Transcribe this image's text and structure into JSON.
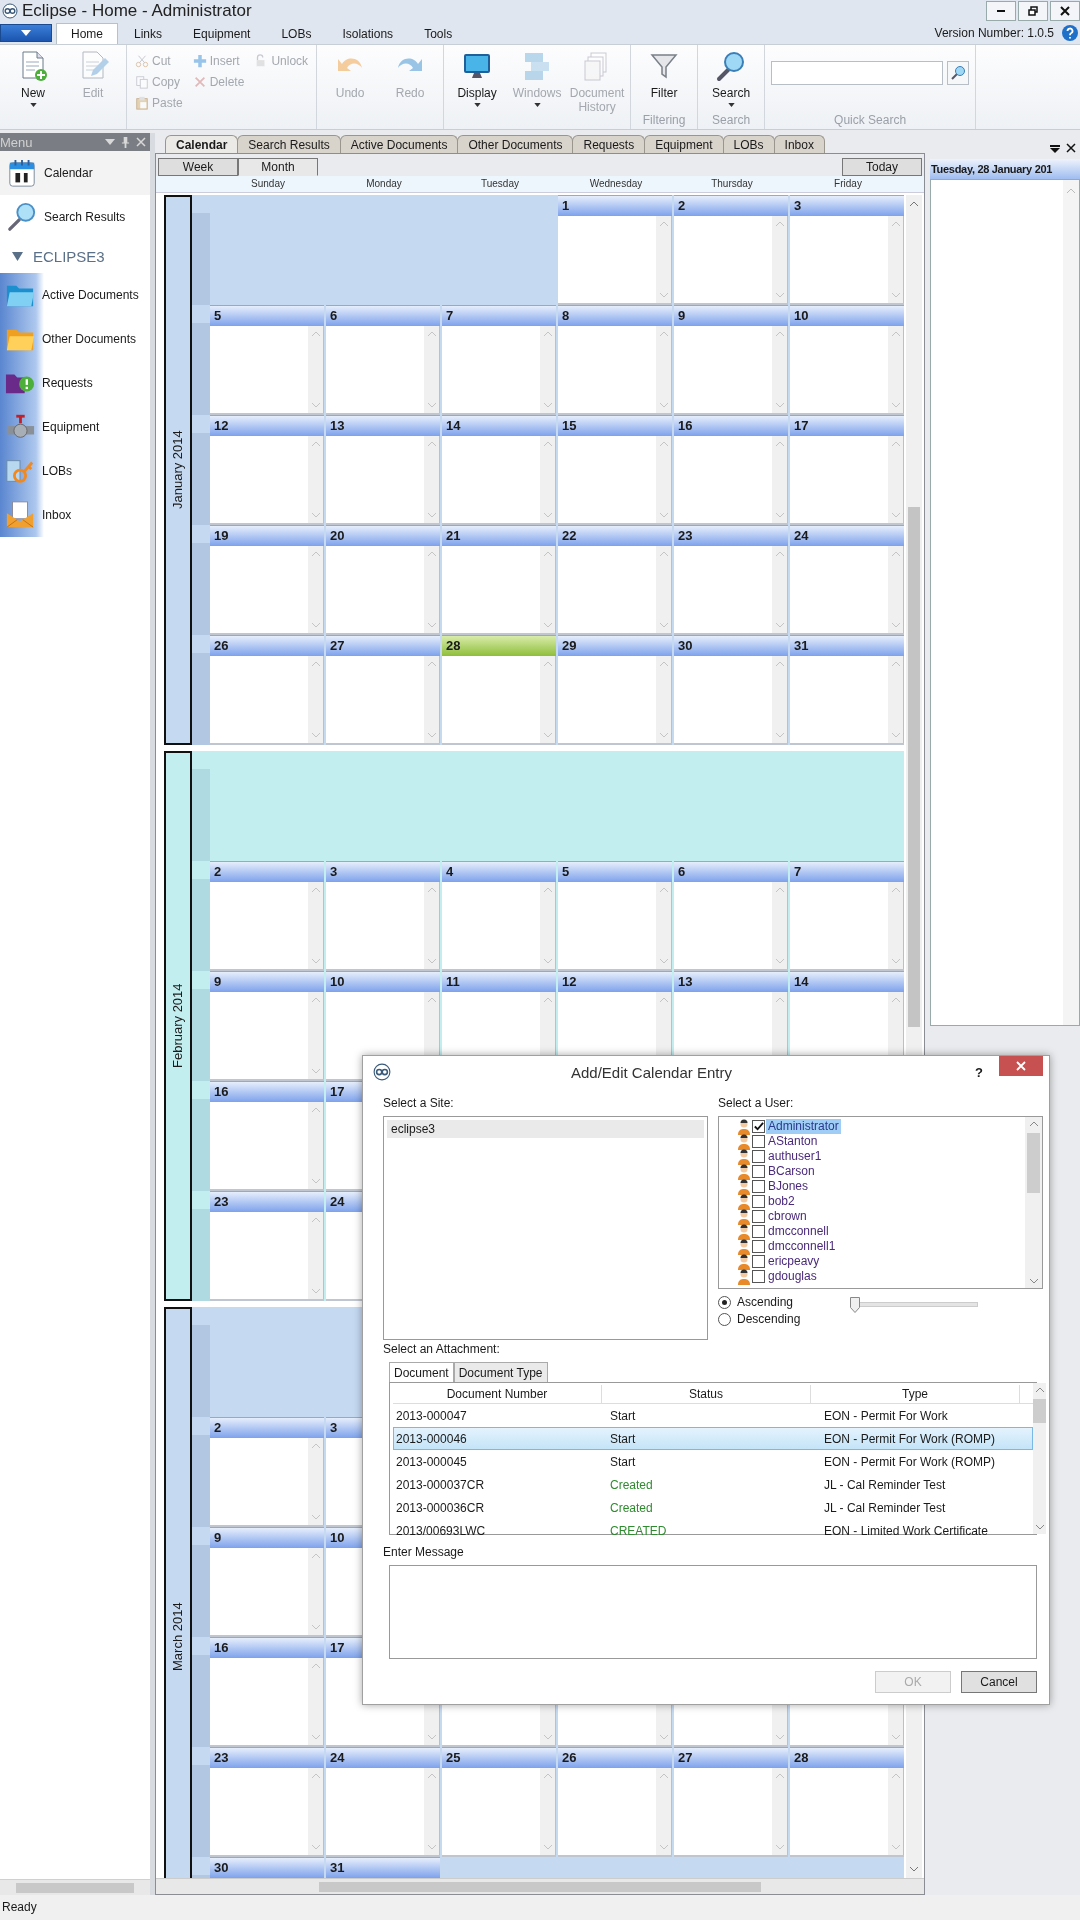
{
  "window": {
    "title": "Eclipse - Home - Administrator"
  },
  "ribbon": {
    "tabs": [
      {
        "label": "Home",
        "selected": true
      },
      {
        "label": "Links",
        "selected": false
      },
      {
        "label": "Equipment",
        "selected": false
      },
      {
        "label": "LOBs",
        "selected": false
      },
      {
        "label": "Isolations",
        "selected": false
      },
      {
        "label": "Tools",
        "selected": false
      }
    ],
    "version": "Version Number: 1.0.5",
    "groups": [
      {
        "kind": "large",
        "buttons": [
          {
            "label": "New",
            "disabled": false,
            "caret": true
          },
          {
            "label": "Edit",
            "disabled": true,
            "caret": false
          }
        ]
      },
      {
        "kind": "small",
        "columns": [
          [
            {
              "label": "Cut",
              "disabled": true
            },
            {
              "label": "Copy",
              "disabled": true
            },
            {
              "label": "Paste",
              "disabled": true
            }
          ],
          [
            {
              "label": "Insert",
              "disabled": true
            },
            {
              "label": "Delete",
              "disabled": true
            }
          ],
          [
            {
              "label": "Unlock",
              "disabled": true
            }
          ]
        ]
      },
      {
        "kind": "large",
        "buttons": [
          {
            "label": "Undo",
            "disabled": true,
            "caret": false
          },
          {
            "label": "Redo",
            "disabled": true,
            "caret": false
          }
        ]
      },
      {
        "kind": "large",
        "buttons": [
          {
            "label": "Display",
            "disabled": false,
            "caret": true
          },
          {
            "label": "Windows",
            "disabled": true,
            "caret": true
          },
          {
            "label": "Document History",
            "disabled": true,
            "caret": false
          }
        ]
      },
      {
        "kind": "large",
        "label": "Filtering",
        "buttons": [
          {
            "label": "Filter",
            "disabled": false,
            "caret": false
          }
        ]
      },
      {
        "kind": "large",
        "label": "Search",
        "buttons": [
          {
            "label": "Search",
            "disabled": false,
            "caret": true
          }
        ]
      },
      {
        "kind": "search",
        "label": "Quick Search"
      }
    ]
  },
  "menu": {
    "title": "Menu",
    "items": [
      {
        "label": "Calendar",
        "selected": true
      },
      {
        "label": "Search Results",
        "selected": false
      }
    ],
    "section": {
      "label": "ECLIPSE3",
      "expanded": true,
      "children": [
        {
          "label": "Active Documents",
          "selected": false
        },
        {
          "label": "Other Documents",
          "selected": false
        },
        {
          "label": "Requests",
          "selected": false
        },
        {
          "label": "Equipment",
          "selected": false
        },
        {
          "label": "LOBs",
          "selected": false
        },
        {
          "label": "Inbox",
          "selected": false
        }
      ]
    }
  },
  "document_tabs": [
    {
      "label": "Calendar",
      "selected": true
    },
    {
      "label": "Search Results",
      "selected": false
    },
    {
      "label": "Active Documents",
      "selected": false
    },
    {
      "label": "Other Documents",
      "selected": false
    },
    {
      "label": "Requests",
      "selected": false
    },
    {
      "label": "Equipment",
      "selected": false
    },
    {
      "label": "LOBs",
      "selected": false
    },
    {
      "label": "Inbox",
      "selected": false
    }
  ],
  "calendar": {
    "views": [
      {
        "label": "Week",
        "selected": false
      },
      {
        "label": "Month",
        "selected": true
      }
    ],
    "today_button": "Today",
    "weekdays": [
      "Sunday",
      "Monday",
      "Tuesday",
      "Wednesday",
      "Thursday",
      "Friday"
    ],
    "months": [
      {
        "label": "January 2014",
        "color": "#c5d9f1",
        "weeks": [
          [
            {
              "kind": "blank"
            },
            {
              "kind": "blank"
            },
            {
              "kind": "blank"
            },
            {
              "kind": "day",
              "day": "1",
              "today": false
            },
            {
              "kind": "day",
              "day": "2",
              "today": false
            },
            {
              "kind": "day",
              "day": "3",
              "today": false
            }
          ],
          [
            {
              "kind": "day",
              "day": "5",
              "today": false
            },
            {
              "kind": "day",
              "day": "6",
              "today": false
            },
            {
              "kind": "day",
              "day": "7",
              "today": false
            },
            {
              "kind": "day",
              "day": "8",
              "today": false
            },
            {
              "kind": "day",
              "day": "9",
              "today": false
            },
            {
              "kind": "day",
              "day": "10",
              "today": false
            }
          ],
          [
            {
              "kind": "day",
              "day": "12",
              "today": false
            },
            {
              "kind": "day",
              "day": "13",
              "today": false
            },
            {
              "kind": "day",
              "day": "14",
              "today": false
            },
            {
              "kind": "day",
              "day": "15",
              "today": false
            },
            {
              "kind": "day",
              "day": "16",
              "today": false
            },
            {
              "kind": "day",
              "day": "17",
              "today": false
            }
          ],
          [
            {
              "kind": "day",
              "day": "19",
              "today": false
            },
            {
              "kind": "day",
              "day": "20",
              "today": false
            },
            {
              "kind": "day",
              "day": "21",
              "today": false
            },
            {
              "kind": "day",
              "day": "22",
              "today": false
            },
            {
              "kind": "day",
              "day": "23",
              "today": false
            },
            {
              "kind": "day",
              "day": "24",
              "today": false
            }
          ],
          [
            {
              "kind": "day",
              "day": "26",
              "today": false
            },
            {
              "kind": "day",
              "day": "27",
              "today": false
            },
            {
              "kind": "day",
              "day": "28",
              "today": true
            },
            {
              "kind": "day",
              "day": "29",
              "today": false
            },
            {
              "kind": "day",
              "day": "30",
              "today": false
            },
            {
              "kind": "day",
              "day": "31",
              "today": false
            }
          ]
        ]
      },
      {
        "label": "February 2014",
        "color": "#c3eef0",
        "weeks": [
          [
            {
              "kind": "blank"
            },
            {
              "kind": "blank"
            },
            {
              "kind": "blank"
            },
            {
              "kind": "blank"
            },
            {
              "kind": "blank"
            },
            {
              "kind": "blank"
            }
          ],
          [
            {
              "kind": "day",
              "day": "2",
              "today": false
            },
            {
              "kind": "day",
              "day": "3",
              "today": false
            },
            {
              "kind": "day",
              "day": "4",
              "today": false
            },
            {
              "kind": "day",
              "day": "5",
              "today": false
            },
            {
              "kind": "day",
              "day": "6",
              "today": false
            },
            {
              "kind": "day",
              "day": "7",
              "today": false
            }
          ],
          [
            {
              "kind": "day",
              "day": "9",
              "today": false
            },
            {
              "kind": "day",
              "day": "10",
              "today": false
            },
            {
              "kind": "day",
              "day": "11",
              "today": false
            },
            {
              "kind": "day",
              "day": "12",
              "today": false
            },
            {
              "kind": "day",
              "day": "13",
              "today": false
            },
            {
              "kind": "day",
              "day": "14",
              "today": false
            }
          ],
          [
            {
              "kind": "day",
              "day": "16",
              "today": false
            },
            {
              "kind": "day",
              "day": "17",
              "today": false
            },
            {
              "kind": "covered"
            },
            {
              "kind": "covered"
            },
            {
              "kind": "covered"
            },
            {
              "kind": "covered"
            }
          ],
          [
            {
              "kind": "day",
              "day": "23",
              "today": false
            },
            {
              "kind": "day",
              "day": "24",
              "today": false
            },
            {
              "kind": "covered"
            },
            {
              "kind": "covered"
            },
            {
              "kind": "covered"
            },
            {
              "kind": "covered"
            }
          ]
        ]
      },
      {
        "label": "March 2014",
        "color": "#c5d9f1",
        "weeks": [
          [
            {
              "kind": "blank"
            },
            {
              "kind": "blank"
            },
            {
              "kind": "blank"
            },
            {
              "kind": "blank"
            },
            {
              "kind": "blank"
            },
            {
              "kind": "blank"
            }
          ],
          [
            {
              "kind": "day",
              "day": "2",
              "today": false
            },
            {
              "kind": "day",
              "day": "3",
              "today": false
            },
            {
              "kind": "covered"
            },
            {
              "kind": "covered"
            },
            {
              "kind": "covered"
            },
            {
              "kind": "covered"
            }
          ],
          [
            {
              "kind": "day",
              "day": "9",
              "today": false
            },
            {
              "kind": "day",
              "day": "10",
              "today": false
            },
            {
              "kind": "covered"
            },
            {
              "kind": "covered"
            },
            {
              "kind": "covered"
            },
            {
              "kind": "covered"
            }
          ],
          [
            {
              "kind": "day",
              "day": "16",
              "today": false
            },
            {
              "kind": "day",
              "day": "17",
              "today": false
            },
            {
              "kind": "hidden"
            },
            {
              "kind": "hidden"
            },
            {
              "kind": "hidden"
            },
            {
              "kind": "hidden"
            }
          ],
          [
            {
              "kind": "day",
              "day": "23",
              "today": false
            },
            {
              "kind": "day",
              "day": "24",
              "today": false
            },
            {
              "kind": "day",
              "day": "25",
              "today": false
            },
            {
              "kind": "day",
              "day": "26",
              "today": false
            },
            {
              "kind": "day",
              "day": "27",
              "today": false
            },
            {
              "kind": "day",
              "day": "28",
              "today": false
            }
          ],
          [
            {
              "kind": "day",
              "day": "30",
              "today": false
            },
            {
              "kind": "day",
              "day": "31",
              "today": false
            },
            {
              "kind": "blank"
            },
            {
              "kind": "blank"
            },
            {
              "kind": "blank"
            },
            {
              "kind": "blank"
            }
          ]
        ]
      }
    ]
  },
  "day_panel": {
    "title": "Tuesday, 28 January 201"
  },
  "dialog": {
    "title": "Add/Edit Calendar Entry",
    "help": "?",
    "site_label": "Select a Site:",
    "sites": [
      {
        "label": "eclipse3",
        "selected": true
      }
    ],
    "user_label": "Select a User:",
    "users": [
      {
        "name": "Administrator",
        "checked": true,
        "selected": true
      },
      {
        "name": "AStanton",
        "checked": false,
        "selected": false
      },
      {
        "name": "authuser1",
        "checked": false,
        "selected": false
      },
      {
        "name": "BCarson",
        "checked": false,
        "selected": false
      },
      {
        "name": "BJones",
        "checked": false,
        "selected": false
      },
      {
        "name": "bob2",
        "checked": false,
        "selected": false
      },
      {
        "name": "cbrown",
        "checked": false,
        "selected": false
      },
      {
        "name": "dmcconnell",
        "checked": false,
        "selected": false
      },
      {
        "name": "dmcconnell1",
        "checked": false,
        "selected": false
      },
      {
        "name": "ericpeavy",
        "checked": false,
        "selected": false
      },
      {
        "name": "gdouglas",
        "checked": false,
        "selected": false
      }
    ],
    "sort": [
      {
        "label": "Ascending",
        "selected": true
      },
      {
        "label": "Descending",
        "selected": false
      }
    ],
    "slider": {
      "level": 0
    },
    "attachment_label": "Select an Attachment:",
    "attachment_tabs": [
      {
        "label": "Document",
        "selected": true
      },
      {
        "label": "Document Type",
        "selected": false
      }
    ],
    "columns": [
      "Document Number",
      "Status",
      "Type"
    ],
    "documents": [
      {
        "number": "2013-000047",
        "status": "Start",
        "type": "EON - Permit For Work",
        "color": "#1a1a1a",
        "selected": false
      },
      {
        "number": "2013-000046",
        "status": "Start",
        "type": "EON - Permit For Work (ROMP)",
        "color": "#1a1a1a",
        "selected": true
      },
      {
        "number": "2013-000045",
        "status": "Start",
        "type": "EON - Permit For Work (ROMP)",
        "color": "#1a1a1a",
        "selected": false
      },
      {
        "number": "2013-000037CR",
        "status": "Created",
        "type": "JL - Cal Reminder Test",
        "color": "#2e8b2e",
        "selected": false
      },
      {
        "number": "2013-000036CR",
        "status": "Created",
        "type": "JL - Cal Reminder Test",
        "color": "#2e8b2e",
        "selected": false
      },
      {
        "number": "2013/00693LWC",
        "status": "CREATED",
        "type": "EON - Limited Work Certificate",
        "color": "#2e8b2e",
        "selected": false
      }
    ],
    "message_label": "Enter Message",
    "buttons": [
      {
        "label": "OK",
        "disabled": true
      },
      {
        "label": "Cancel",
        "disabled": false
      }
    ]
  },
  "status_bar": "Ready"
}
